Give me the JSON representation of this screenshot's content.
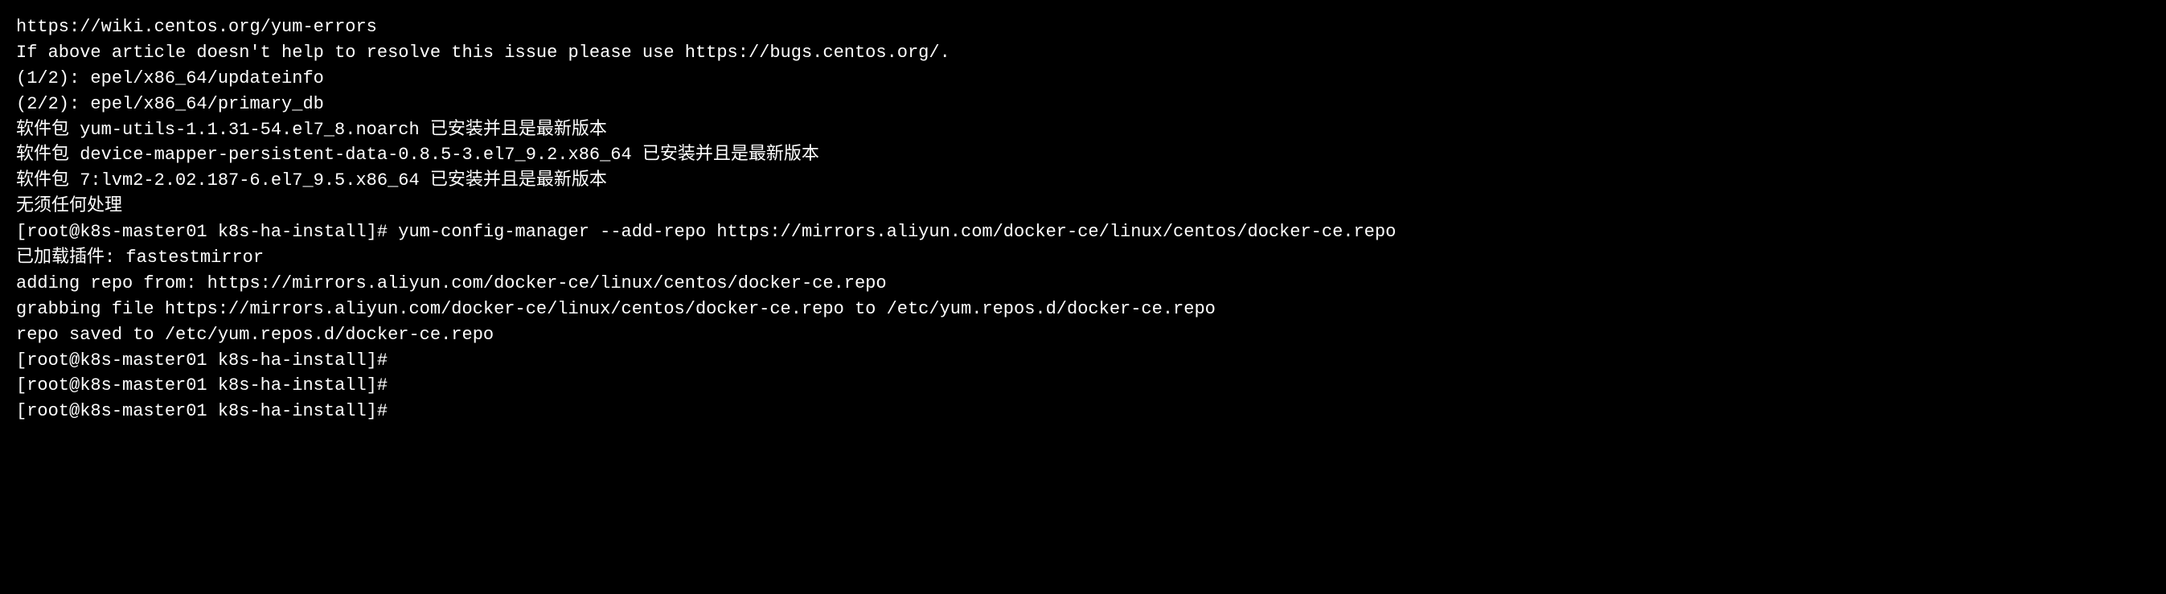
{
  "terminal": {
    "lines": [
      {
        "id": "line-1",
        "text": "https://wiki.centos.org/yum-errors"
      },
      {
        "id": "line-blank-1",
        "text": ""
      },
      {
        "id": "line-2",
        "text": "If above article doesn't help to resolve this issue please use https://bugs.centos.org/."
      },
      {
        "id": "line-blank-2",
        "text": ""
      },
      {
        "id": "line-3",
        "text": "(1/2): epel/x86_64/updateinfo"
      },
      {
        "id": "line-4",
        "text": "(2/2): epel/x86_64/primary_db"
      },
      {
        "id": "line-5",
        "text": "软件包 yum-utils-1.1.31-54.el7_8.noarch 已安装并且是最新版本"
      },
      {
        "id": "line-6",
        "text": "软件包 device-mapper-persistent-data-0.8.5-3.el7_9.2.x86_64 已安装并且是最新版本"
      },
      {
        "id": "line-7",
        "text": "软件包 7:lvm2-2.02.187-6.el7_9.5.x86_64 已安装并且是最新版本"
      },
      {
        "id": "line-8",
        "text": "无须任何处理"
      },
      {
        "id": "line-9",
        "text": "[root@k8s-master01 k8s-ha-install]# yum-config-manager --add-repo https://mirrors.aliyun.com/docker-ce/linux/centos/docker-ce.repo"
      },
      {
        "id": "line-10",
        "text": "已加载插件: fastestmirror"
      },
      {
        "id": "line-11",
        "text": "adding repo from: https://mirrors.aliyun.com/docker-ce/linux/centos/docker-ce.repo"
      },
      {
        "id": "line-12",
        "text": "grabbing file https://mirrors.aliyun.com/docker-ce/linux/centos/docker-ce.repo to /etc/yum.repos.d/docker-ce.repo"
      },
      {
        "id": "line-13",
        "text": "repo saved to /etc/yum.repos.d/docker-ce.repo"
      },
      {
        "id": "line-14",
        "text": "[root@k8s-master01 k8s-ha-install]#"
      },
      {
        "id": "line-15",
        "text": "[root@k8s-master01 k8s-ha-install]#"
      },
      {
        "id": "line-16",
        "text": "[root@k8s-master01 k8s-ha-install]#"
      }
    ]
  }
}
